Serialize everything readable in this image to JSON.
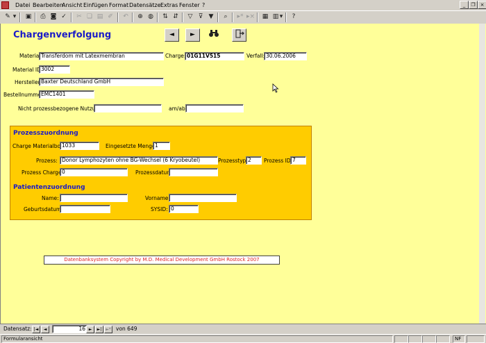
{
  "menu": {
    "items": [
      "Datei",
      "Bearbeiten",
      "Ansicht",
      "Einfügen",
      "Format",
      "Datensätze",
      "Extras",
      "Fenster",
      "?"
    ]
  },
  "window_buttons": [
    "_",
    "̈",
    "x"
  ],
  "toolbar_icons": [
    "design-view-icon",
    "save-icon",
    "print-icon",
    "print-preview-icon",
    "spellcheck-icon",
    "cut-icon",
    "copy-icon",
    "paste-icon",
    "format-painter-icon",
    "undo-icon",
    "insert-hyperlink-icon",
    "web-toolbar-icon",
    "sort-ascending-icon",
    "sort-descending-icon",
    "filter-by-selection-icon",
    "filter-by-form-icon",
    "apply-filter-icon",
    "find-icon",
    "new-record-icon",
    "delete-record-icon",
    "properties-icon",
    "database-window-icon",
    "new-object-icon",
    "help-icon"
  ],
  "form": {
    "title": "Chargenverfolgung",
    "nav": {
      "prev": "◄",
      "next": "►",
      "find": "find-icon",
      "exit": "exit-icon"
    },
    "material_label": "Material:",
    "material_value": "Transferdom mit Latexmembran",
    "charge_label": "Charge:",
    "charge_value": "01G11V515",
    "verfall_label": "Verfall:",
    "verfall_value": "30.06.2006",
    "material_id_label": "Material ID:",
    "material_id_value": "3002",
    "hersteller_label": "Hersteller:",
    "hersteller_value": "Baxter Deutschland GmbH",
    "bestellnummer_label": "Bestellnummer:",
    "bestellnummer_value": "EMC1401",
    "nutzung_label": "Nicht prozessbezogene Nutzung:",
    "nutzung_value": "",
    "amab_label": "am/ab:",
    "amab_value": ""
  },
  "prozess": {
    "heading": "Prozesszuordnung",
    "charge_materialbox_label": "Charge Materialbox:",
    "charge_materialbox_value": "1033",
    "menge_label": "Eingesetzte Menge:",
    "menge_value": "1",
    "prozess_label": "Prozess:",
    "prozess_value": "Donor Lymphozyten ohne BG-Wechsel (6 Kryobeutel)",
    "prozesstyp_label": "Prozesstyp:",
    "prozesstyp_value": "2",
    "prozess_id_label": "Prozess ID:",
    "prozess_id_value": "7",
    "prozess_charge_label": "Prozess Charge:",
    "prozess_charge_value": "0",
    "prozessdatum_label": "Prozessdatum:",
    "prozessdatum_value": ""
  },
  "patient": {
    "heading": "Patientenzuordnung",
    "name_label": "Name:",
    "name_value": "",
    "vorname_label": "Vorname:",
    "vorname_value": "",
    "geburtsdatum_label": "Geburtsdatum:",
    "geburtsdatum_value": "",
    "sysid_label": "SYSID:",
    "sysid_value": "0"
  },
  "copyright": "Datenbanksystem Copyright by M.D. Medical Development GmbH Rostock 2007",
  "record_nav": {
    "label": "Datensatz:",
    "current": "16",
    "total_text": "von 649",
    "first": "|◄",
    "prev": "◄",
    "next": "►",
    "last": "►|",
    "new": "►*"
  },
  "status": {
    "view": "Formularansicht",
    "nf": "NF"
  }
}
